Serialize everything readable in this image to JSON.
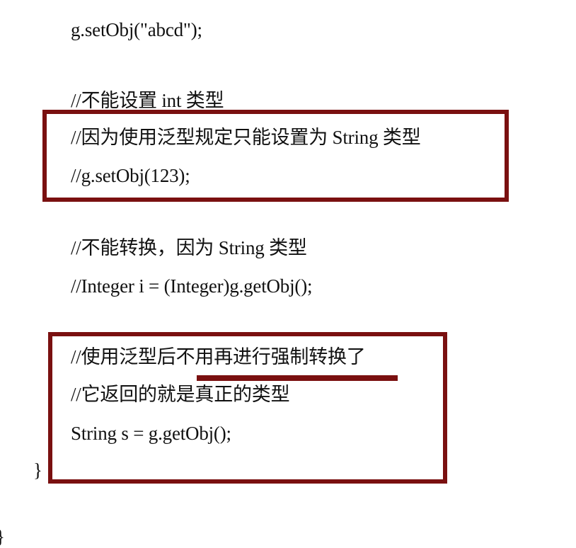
{
  "code": {
    "line_setobj": "g.setObj(\"abcd\");",
    "comment_no_int": "//不能设置 int 类型",
    "comment_generic_reason": "//因为使用泛型规定只能设置为 String 类型",
    "comment_setobj_123": "//g.setObj(123);",
    "comment_no_convert": "//不能转换，因为 String 类型",
    "comment_integer_cast": "//Integer i = (Integer)g.getObj();",
    "comment_no_cast_needed": "//使用泛型后不用再进行强制转换了",
    "comment_real_type": "//它返回的就是真正的类型",
    "line_string_s": "String s = g.getObj();",
    "closing_brace": "}",
    "closing_brace_outer": "}"
  },
  "highlight_color": "#7a1010"
}
